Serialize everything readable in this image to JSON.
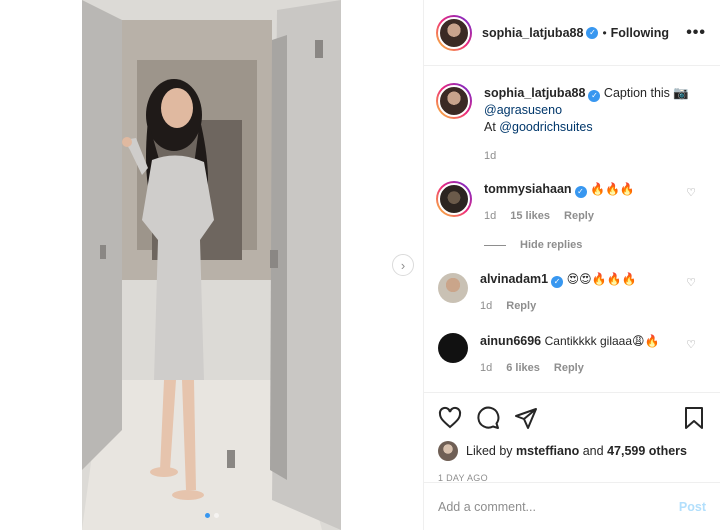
{
  "post": {
    "author": "sophia_latjuba88",
    "following_label": "Following",
    "separator": "•",
    "more_label": "•••",
    "image_alt": "Woman in a grey robe standing in an open doorway",
    "carousel_dots": 2,
    "carousel_active": 0
  },
  "caption": {
    "author": "sophia_latjuba88",
    "text": "Caption this 📷",
    "mention": "@agrasuseno",
    "location_prefix": "At",
    "location_mention": "@goodrichsuites",
    "time": "1d"
  },
  "comments": [
    {
      "author": "tommysiahaan",
      "verified": true,
      "text": "🔥🔥🔥",
      "time": "1d",
      "likes": "15 likes",
      "reply": "Reply"
    },
    {
      "author": "alvinadam1",
      "verified": true,
      "text": "😍😍🔥🔥🔥",
      "time": "1d",
      "likes": "",
      "reply": "Reply"
    },
    {
      "author": "ainun6696",
      "verified": false,
      "text": "Cantikkkk gilaaa😩🔥",
      "time": "1d",
      "likes": "6 likes",
      "reply": "Reply"
    }
  ],
  "hide_replies": "Hide replies",
  "likes_line": {
    "prefix": "Liked by",
    "user": "msteffiano",
    "middle": "and",
    "count": "47,599 others"
  },
  "timestamp": "1 DAY AGO",
  "add_comment": {
    "placeholder": "Add a comment...",
    "post_label": "Post"
  },
  "colors": {
    "verified": "#3897f0",
    "link": "#00376b",
    "muted": "#8e8e8e",
    "post_disabled": "#b2dffc"
  }
}
